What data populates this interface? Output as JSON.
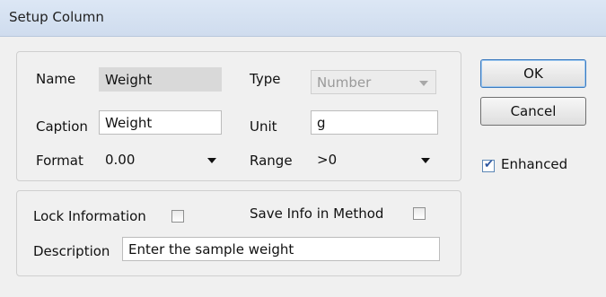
{
  "window": {
    "title": "Setup Column"
  },
  "setup": {
    "name_label": "Name",
    "name_value": "Weight",
    "type_label": "Type",
    "type_value": "Number",
    "caption_label": "Caption",
    "caption_value": "Weight",
    "unit_label": "Unit",
    "unit_value": "g",
    "format_label": "Format",
    "format_value": "0.00",
    "range_label": "Range",
    "range_value": ">0"
  },
  "info": {
    "lock_label": "Lock Information",
    "lock_checked": false,
    "save_label": "Save Info in Method",
    "save_checked": false,
    "description_label": "Description",
    "description_value": "Enter the sample weight"
  },
  "buttons": {
    "ok": "OK",
    "cancel": "Cancel"
  },
  "enhanced": {
    "label": "Enhanced",
    "checked": true
  }
}
